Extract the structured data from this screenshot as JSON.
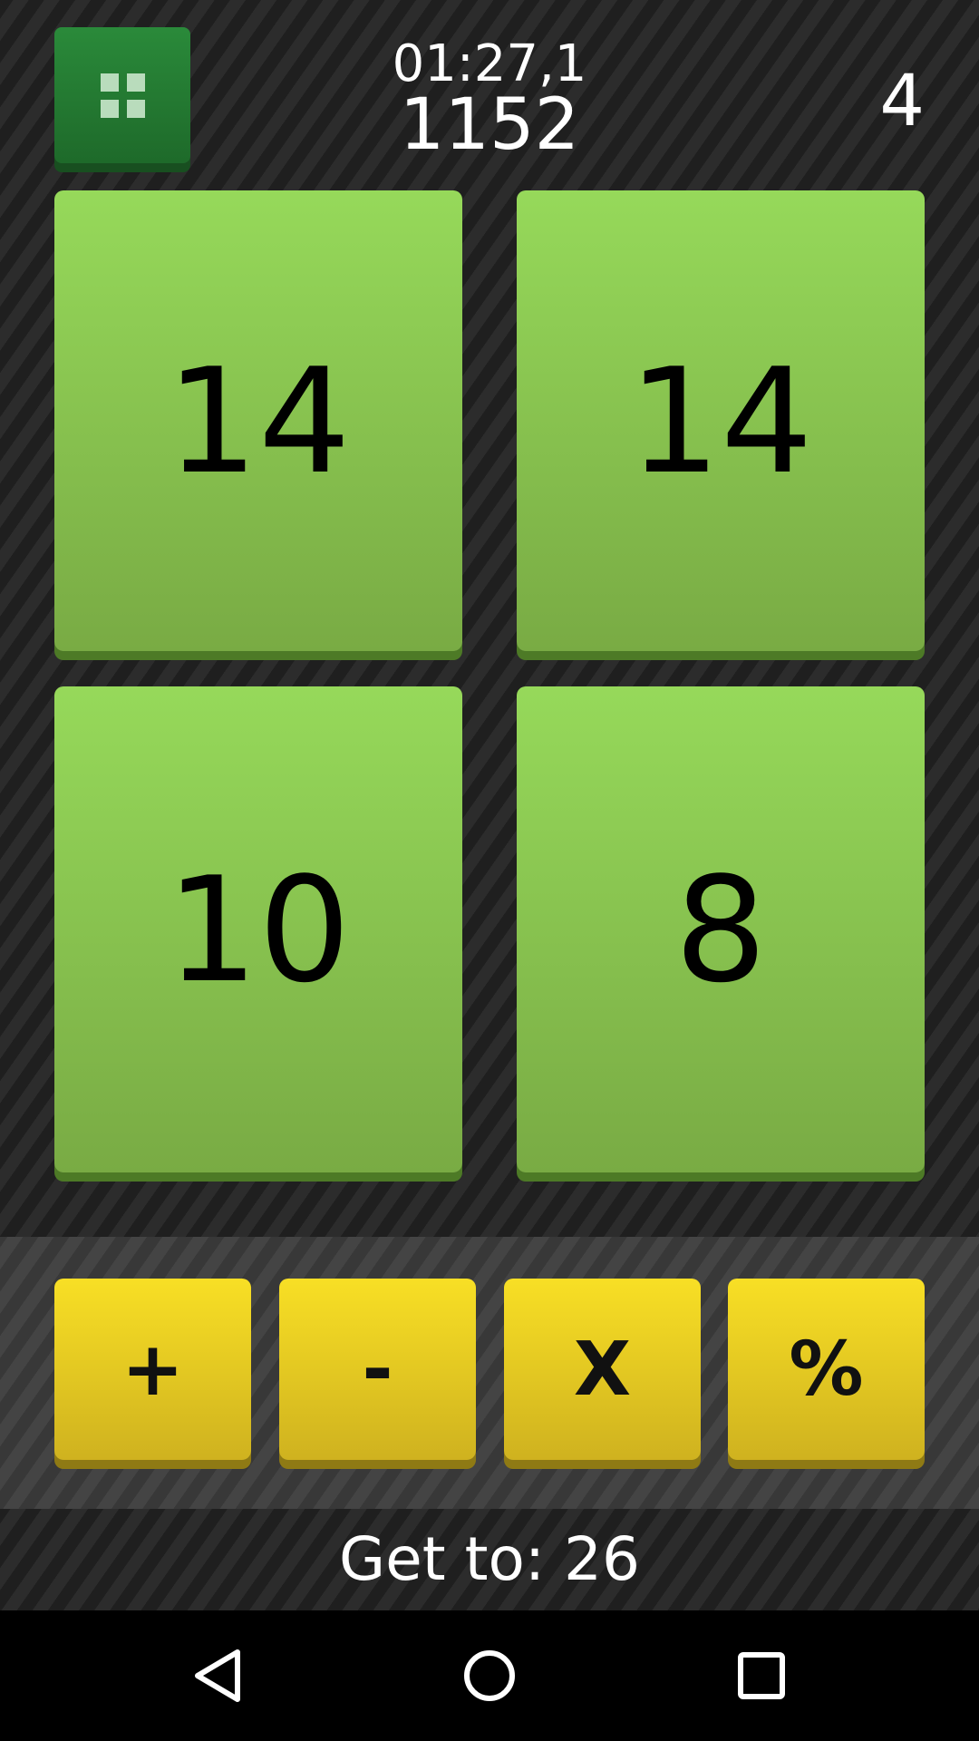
{
  "header": {
    "menu_icon": "grid-icon",
    "timer": "01:27,1",
    "score": "1152",
    "level": "4"
  },
  "cards": [
    {
      "value": "14"
    },
    {
      "value": "14"
    },
    {
      "value": "10"
    },
    {
      "value": "8"
    }
  ],
  "operators": [
    {
      "label": "+"
    },
    {
      "label": "-"
    },
    {
      "label": "X"
    },
    {
      "label": "%"
    }
  ],
  "goal": {
    "text": "Get to: 26"
  },
  "navbar": {
    "icons": [
      "back-icon",
      "home-icon",
      "recents-icon"
    ]
  },
  "colors": {
    "card": "#8cc850",
    "operator": "#f2d724",
    "menu_button": "#247a32",
    "background": "#262626"
  }
}
